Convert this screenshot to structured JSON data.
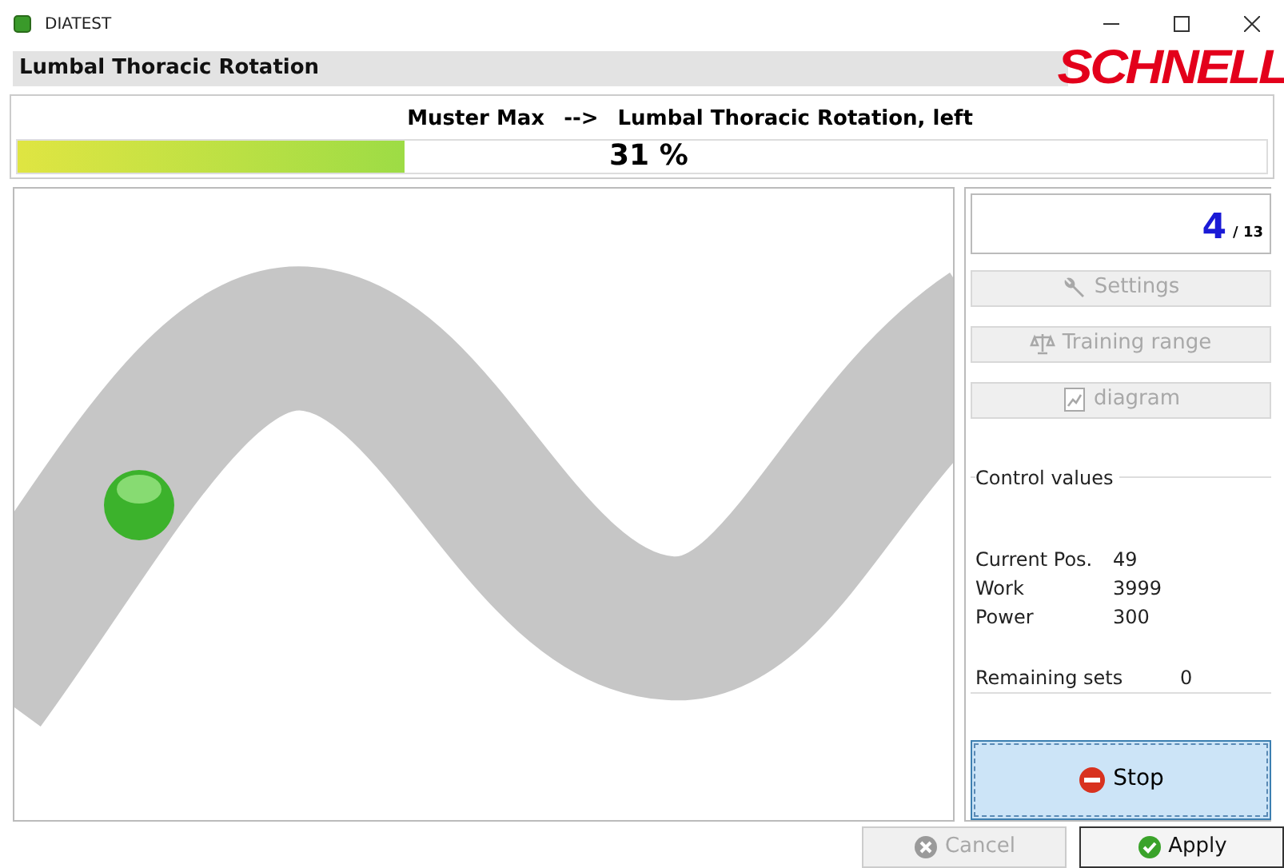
{
  "window": {
    "title": "DIATEST"
  },
  "header": {
    "title": "Lumbal Thoracic Rotation",
    "logo": "SCHNELL"
  },
  "session": {
    "patient": "Muster Max",
    "arrow": "-->",
    "exercise": "Lumbal Thoracic Rotation, left"
  },
  "progress": {
    "level": 0.31,
    "reading": "31 %"
  },
  "counter": {
    "current": "4",
    "total": "/ 13"
  },
  "tools": [
    {
      "label": "Settings",
      "disabled": true
    },
    {
      "label": "Training range",
      "disabled": true
    },
    {
      "label": "diagram",
      "disabled": true
    }
  ],
  "control_values": {
    "title": "Control values",
    "rows": [
      {
        "label": "Current Pos.",
        "value": "49"
      },
      {
        "label": "Work",
        "value": "3999"
      },
      {
        "label": "Power",
        "value": "300"
      }
    ],
    "remaining": {
      "label": "Remaining sets",
      "value": "0"
    }
  },
  "stop_button": {
    "label": "Stop",
    "focused": true
  },
  "footer_buttons": [
    {
      "label": "Cancel",
      "disabled": true
    },
    {
      "label": "Apply",
      "disabled": false
    }
  ]
}
